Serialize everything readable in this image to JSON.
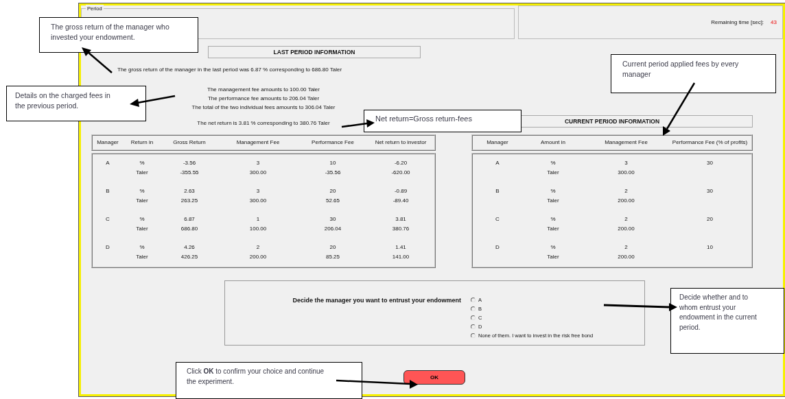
{
  "window": {
    "period_label": "Period",
    "remaining_time_label": "Remaining time [sec]:",
    "remaining_time": "43"
  },
  "last_period": {
    "title": "LAST PERIOD INFORMATION",
    "gross_text": "The gross return of the manager in the last period was 6.87 % corresponding to 686.80 Taler",
    "fee_lines": [
      "The management fee amounts to 100.00 Taler",
      "The performance fee amounts to 206.04 Taler",
      "The total of the two individual fees amounts to 306.04 Taler"
    ],
    "net_text": "The net return is 3.81 % corresponding to 380.76 Taler"
  },
  "last_table": {
    "columns": [
      "Manager",
      "Return in",
      "Gross Return",
      "Management Fee",
      "Performance Fee",
      "Net return to investor"
    ],
    "rows": [
      {
        "manager": "A",
        "lines": [
          [
            "%",
            "-3.56",
            "3",
            "10",
            "-6.20"
          ],
          [
            "Taler",
            "-355.55",
            "300.00",
            "-35.56",
            "-620.00"
          ]
        ]
      },
      {
        "manager": "B",
        "lines": [
          [
            "%",
            "2.63",
            "3",
            "20",
            "-0.89"
          ],
          [
            "Taler",
            "263.25",
            "300.00",
            "52.65",
            "-89.40"
          ]
        ]
      },
      {
        "manager": "C",
        "lines": [
          [
            "%",
            "6.87",
            "1",
            "30",
            "3.81"
          ],
          [
            "Taler",
            "686.80",
            "100.00",
            "206.04",
            "380.76"
          ]
        ]
      },
      {
        "manager": "D",
        "lines": [
          [
            "%",
            "4.26",
            "2",
            "20",
            "1.41"
          ],
          [
            "Taler",
            "426.25",
            "200.00",
            "85.25",
            "141.00"
          ]
        ]
      }
    ]
  },
  "current_period": {
    "title": "CURRENT PERIOD INFORMATION"
  },
  "current_table": {
    "columns": [
      "Manager",
      "Amount in",
      "Management Fee",
      "Performance Fee (% of profits)"
    ],
    "rows": [
      {
        "manager": "A",
        "lines": [
          [
            "%",
            "3",
            "30"
          ],
          [
            "Taler",
            "300.00"
          ]
        ]
      },
      {
        "manager": "B",
        "lines": [
          [
            "%",
            "2",
            "30"
          ],
          [
            "Taler",
            "200.00"
          ]
        ]
      },
      {
        "manager": "C",
        "lines": [
          [
            "%",
            "2",
            "20"
          ],
          [
            "Taler",
            "200.00"
          ]
        ]
      },
      {
        "manager": "D",
        "lines": [
          [
            "%",
            "2",
            "10"
          ],
          [
            "Taler",
            "200.00"
          ]
        ]
      }
    ]
  },
  "decision": {
    "prompt": "Decide the manager you want to entrust your endowment",
    "options": [
      {
        "label": "A",
        "selected": false
      },
      {
        "label": "B",
        "selected": false
      },
      {
        "label": "C",
        "selected": false
      },
      {
        "label": "D",
        "selected": false
      },
      {
        "label": "None of them. I want to invest in the risk free bond",
        "selected": false
      }
    ]
  },
  "ok_button": "OK",
  "annotations": [
    {
      "text": "The gross return of the manager who invested your endowment."
    },
    {
      "text": "Details on the charged fees in the previous period."
    },
    {
      "text": "Net return=Gross return-fees"
    },
    {
      "text": "Current period applied fees by every manager"
    },
    {
      "text": "Decide whether and to whom entrust your endowment in the current period."
    },
    {
      "text": "Click **OK** to confirm your choice and continue the experiment."
    }
  ]
}
